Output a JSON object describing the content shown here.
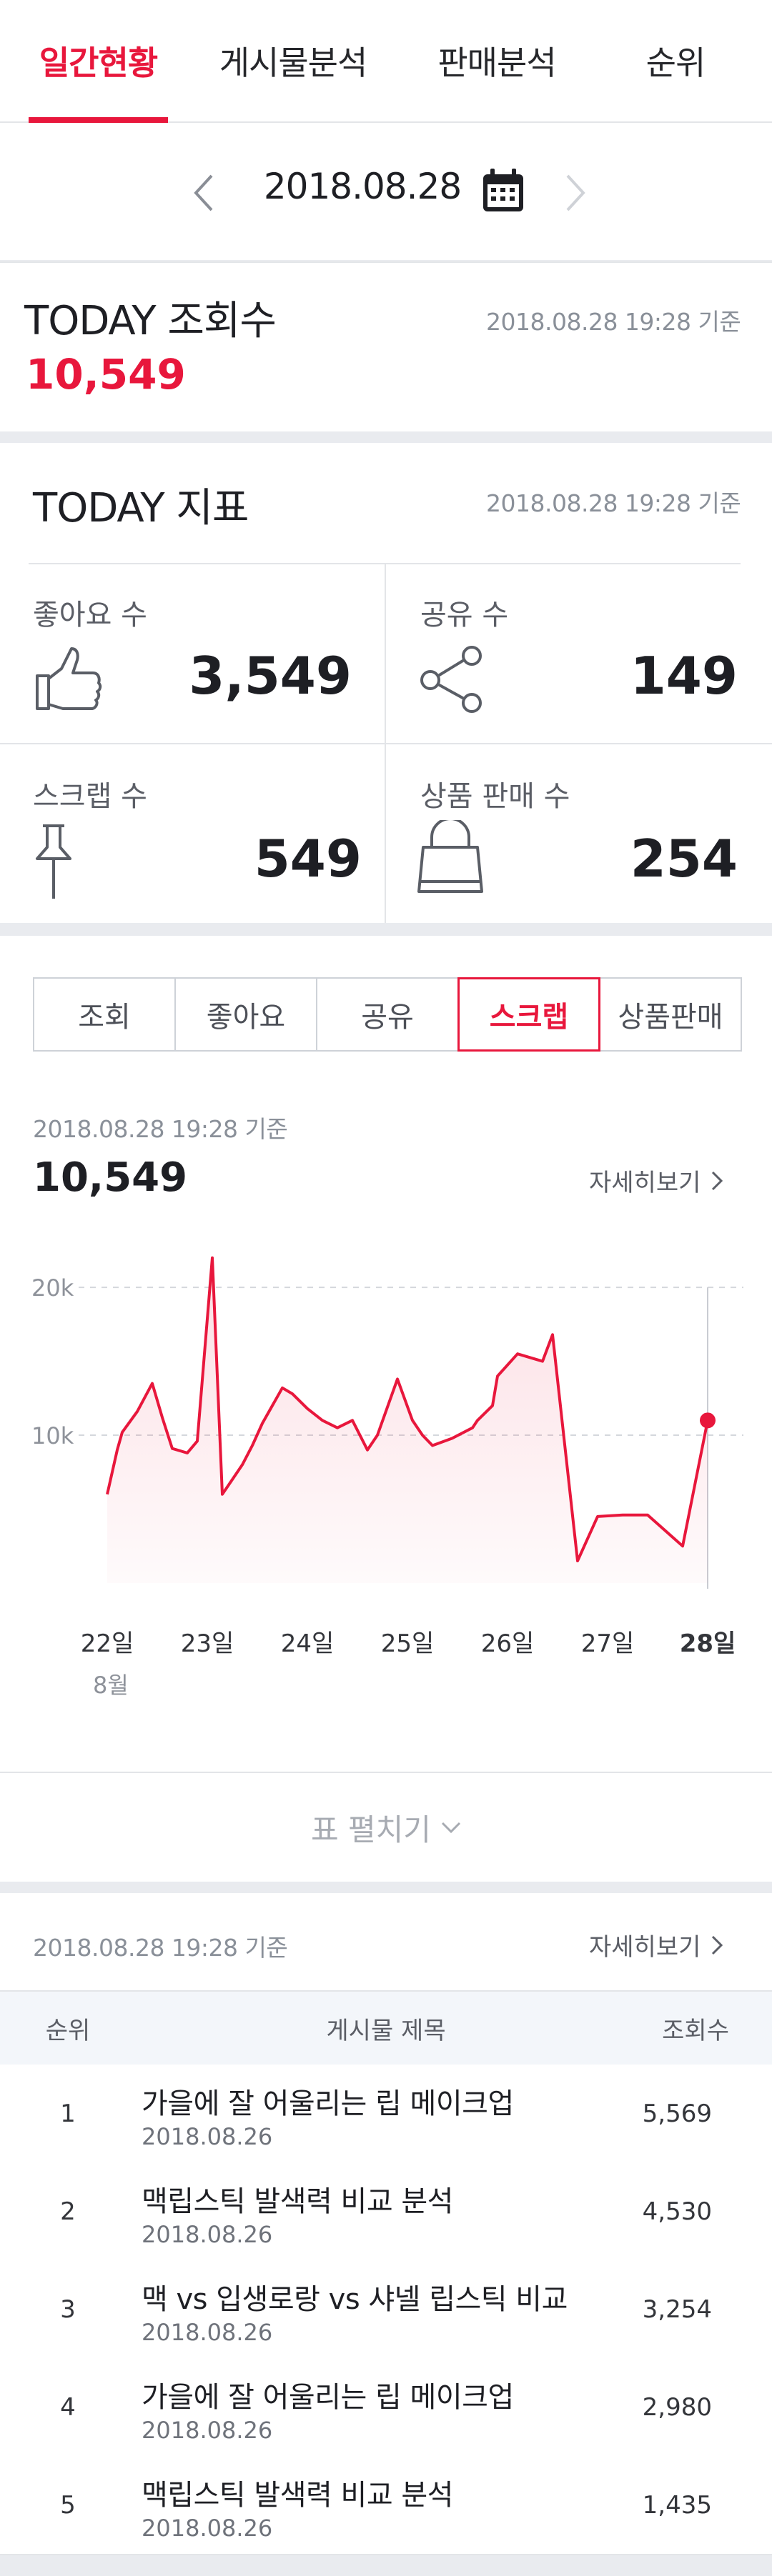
{
  "tabs": [
    {
      "label": "일간현황",
      "active": true
    },
    {
      "label": "게시물분석",
      "active": false
    },
    {
      "label": "판매분석",
      "active": false
    },
    {
      "label": "순위",
      "active": false
    }
  ],
  "date_bar": {
    "date": "2018.08.28",
    "icon": "calendar-icon",
    "prev_icon": "chevron-left-icon",
    "next_icon": "chevron-right-icon"
  },
  "today_views": {
    "title": "TODAY 조회수",
    "stamp": "2018.08.28 19:28 기준",
    "value": "10,549"
  },
  "today_metrics": {
    "title": "TODAY 지표",
    "stamp": "2018.08.28 19:28 기준",
    "items": [
      {
        "label": "좋아요 수",
        "value": "3,549",
        "icon": "thumbs-up-icon"
      },
      {
        "label": "공유 수",
        "value": "149",
        "icon": "share-icon"
      },
      {
        "label": "스크랩 수",
        "value": "549",
        "icon": "pin-icon"
      },
      {
        "label": "상품 판매 수",
        "value": "254",
        "icon": "shopping-bag-icon"
      }
    ]
  },
  "metric_tabs": [
    {
      "label": "조회",
      "active": false
    },
    {
      "label": "좋아요",
      "active": false
    },
    {
      "label": "공유",
      "active": false
    },
    {
      "label": "스크랩",
      "active": true
    },
    {
      "label": "상품판매",
      "active": false
    }
  ],
  "chart_section": {
    "stamp": "2018.08.28 19:28 기준",
    "value": "10,549",
    "detail_link": "자세히보기",
    "month_label": "8월",
    "expand_label": "표 펼치기"
  },
  "chart_data": {
    "type": "area",
    "x": [
      22.0,
      22.1,
      22.15,
      22.3,
      22.45,
      22.55,
      22.65,
      22.8,
      22.9,
      23.05,
      23.15,
      23.25,
      23.35,
      23.45,
      23.55,
      23.75,
      23.85,
      24.0,
      24.15,
      24.3,
      24.45,
      24.6,
      24.7,
      24.9,
      25.05,
      25.15,
      25.25,
      25.45,
      25.65,
      25.7,
      25.85,
      25.9,
      26.1,
      26.35,
      26.45,
      26.7,
      26.9,
      27.15,
      27.4,
      27.75,
      28.0
    ],
    "y": [
      6000,
      9000,
      10200,
      11600,
      13500,
      11200,
      9100,
      8800,
      9600,
      22000,
      6000,
      7000,
      8000,
      9300,
      10800,
      13200,
      12800,
      11800,
      11000,
      10500,
      11000,
      9000,
      10000,
      13800,
      11000,
      10000,
      9300,
      9800,
      10500,
      11000,
      12000,
      14000,
      15500,
      15000,
      16800,
      1500,
      4500,
      4600,
      4600,
      2500,
      11000
    ],
    "categories": [
      "22일",
      "23일",
      "24일",
      "25일",
      "26일",
      "27일",
      "28일"
    ],
    "yticks": [
      "10k",
      "20k"
    ],
    "ylim": [
      0,
      23000
    ],
    "highlight": "28일",
    "color": "#e8173c"
  },
  "ranking": {
    "stamp": "2018.08.28 19:28 기준",
    "detail_link": "자세히보기",
    "headers": {
      "rank": "순위",
      "title": "게시물 제목",
      "views": "조회수"
    },
    "rows": [
      {
        "rank": "1",
        "title": "가을에 잘 어울리는 립 메이크업",
        "date": "2018.08.26",
        "views": "5,569"
      },
      {
        "rank": "2",
        "title": "맥립스틱 발색력 비교 분석",
        "date": "2018.08.26",
        "views": "4,530"
      },
      {
        "rank": "3",
        "title": "맥 vs 입생로랑 vs 샤넬 립스틱 비교",
        "date": "2018.08.26",
        "views": "3,254"
      },
      {
        "rank": "4",
        "title": "가을에 잘 어울리는 립 메이크업",
        "date": "2018.08.26",
        "views": "2,980"
      },
      {
        "rank": "5",
        "title": "맥립스틱 발색력 비교 분석",
        "date": "2018.08.26",
        "views": "1,435"
      }
    ]
  }
}
